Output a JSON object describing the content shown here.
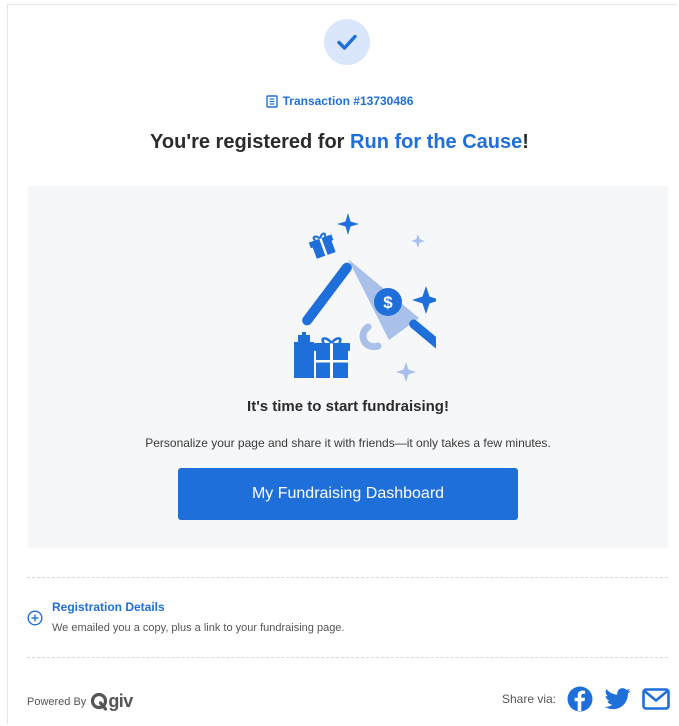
{
  "transaction": {
    "label": "Transaction #13730486",
    "icon": "receipt-icon"
  },
  "headline": {
    "prefix": "You're registered for ",
    "event_name": "Run for the Cause",
    "suffix": "!"
  },
  "card": {
    "illustration": "megaphone-gift-icon",
    "title": "It's time to start fundraising!",
    "subtitle": "Personalize your page and share it with friends—it only takes a few minutes.",
    "button_label": "My Fundraising Dashboard"
  },
  "details": {
    "title": "Registration Details",
    "subtitle": "We emailed you a copy, plus a link to your fundraising page.",
    "icon": "plus-circle-icon"
  },
  "footer": {
    "powered_by": "Powered By",
    "logo_text": "giv",
    "share_label": "Share via:",
    "share_targets": [
      "facebook-icon",
      "twitter-icon",
      "email-icon"
    ]
  },
  "colors": {
    "brand_blue": "#1e6fd9",
    "light_blue": "#d9e6fb",
    "card_bg": "#f6f7f9",
    "text": "#2b2b2b"
  }
}
